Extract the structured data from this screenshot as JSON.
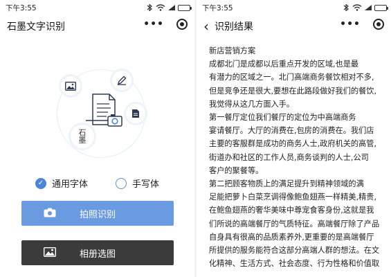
{
  "left": {
    "status_time": "下午3:55",
    "status_battery": "",
    "title": "石墨文字识别",
    "options": [
      {
        "label": "通用字体",
        "selected": true
      },
      {
        "label": "手写体",
        "selected": false
      }
    ],
    "camera_button": "拍照识别",
    "album_button": "相册选图",
    "illustration_text": "石\n墨",
    "colors": {
      "primary": "#6a9ae0",
      "dark": "#3b3b3b"
    }
  },
  "right": {
    "status_time": "下午3:55",
    "title": "识别结果",
    "lines": [
      "新店营销方案",
      "成都北门是成都以后重点开发的区域,也是最",
      "有潜力的区域之一。北门高端商务餐饮相对不多,",
      "但是竞争还是很大,要想在此路段做好我们的餐饮,",
      "我觉得从这几方面入手。",
      "第一餐厅定位我们餐厅的定位为中高端商务",
      "宴请餐厅。大厅的消费在,包房的消费在。我们店",
      "主要的客服群是成功的商务人士,政府机关的高管,",
      "街道办和社区的工作人员,商务谈判的人士,公司",
      "客户的聚餐等。",
      "第二把顾客物质上的满足提升到精神领域的满",
      "足能把萝卜白菜烹调得像鲍鱼翅燕一样精美,精贵,",
      "在鲍鱼翅燕的奢华美味中尊宠食客身份,这就是我",
      "们所说的高端餐厅的气质特征。高端餐厅除了产品",
      "自身具有很高的品质素养外,更重要的是高端餐厅",
      "所提供的服务能符合这部分高端人群的想法。在文",
      "化精神、生活方式、社会态度、行为性格和价值取"
    ]
  }
}
